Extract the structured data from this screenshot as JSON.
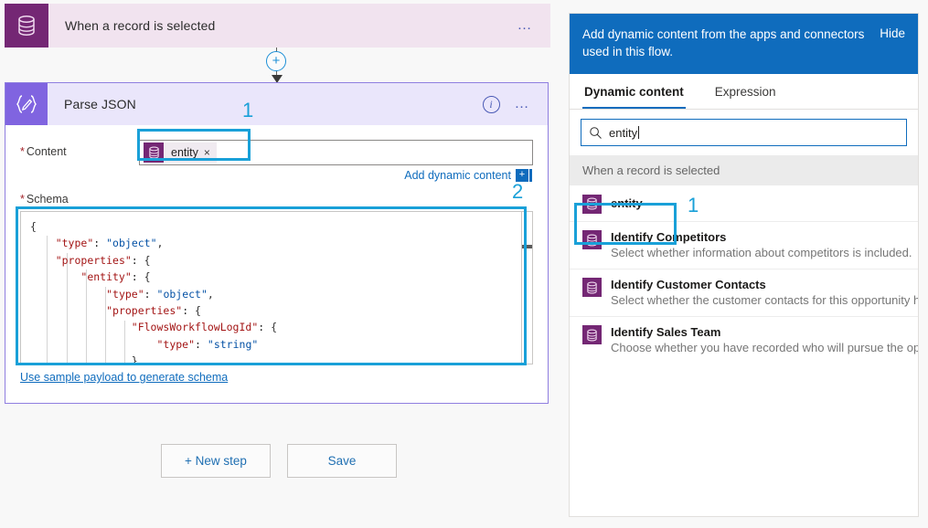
{
  "designer": {
    "trigger": {
      "title": "When a record is selected",
      "icon": "database-icon",
      "menu_label": "…"
    },
    "connector": {
      "add_label": "+",
      "icon": "add-step-plus-icon"
    },
    "action": {
      "title": "Parse JSON",
      "icon": "parse-json-braces-icon",
      "info_label": "i",
      "menu_label": "…",
      "content_label": "Content",
      "required_mark": "*",
      "token": {
        "label": "entity",
        "remove_label": "×",
        "icon": "database-icon"
      },
      "add_dynamic_content_link": "Add dynamic content",
      "add_dynamic_content_plus": "+",
      "schema_label": "Schema",
      "schema_code": "{\n    \"type\": \"object\",\n    \"properties\": {\n        \"entity\": {\n            \"type\": \"object\",\n            \"properties\": {\n                \"FlowsWorkflowLogId\": {\n                    \"type\": \"string\"\n                },",
      "sample_payload_link": "Use sample payload to generate schema"
    },
    "buttons": {
      "new_step": "+ New step",
      "save": "Save"
    },
    "annotations": [
      {
        "label": "1",
        "color": "#19a0d8"
      },
      {
        "label": "2",
        "color": "#19a0d8"
      }
    ]
  },
  "dynamic_panel": {
    "header_text": "Add dynamic content from the apps and connectors used in this flow.",
    "hide_label": "Hide",
    "tabs": [
      {
        "label": "Dynamic content",
        "active": true
      },
      {
        "label": "Expression",
        "active": false
      }
    ],
    "search": {
      "value": "entity",
      "icon": "search-icon"
    },
    "group_header": "When a record is selected",
    "items": [
      {
        "title": "entity",
        "description": "",
        "icon": "database-icon",
        "highlighted": true
      },
      {
        "title": "Identify Competitors",
        "description": "Select whether information about competitors is included.",
        "icon": "database-icon",
        "highlighted": false
      },
      {
        "title": "Identify Customer Contacts",
        "description": "Select whether the customer contacts for this opportunity ha…",
        "icon": "database-icon",
        "highlighted": false
      },
      {
        "title": "Identify Sales Team",
        "description": "Choose whether you have recorded who will pursue the opp…",
        "icon": "database-icon",
        "highlighted": false
      }
    ],
    "annotation": {
      "label": "1",
      "color": "#19a0d8"
    }
  },
  "colors": {
    "accent_blue": "#0f6cbd",
    "highlight_cyan": "#19a0d8",
    "trigger_purple": "#742774",
    "action_purple": "#8064e0"
  }
}
